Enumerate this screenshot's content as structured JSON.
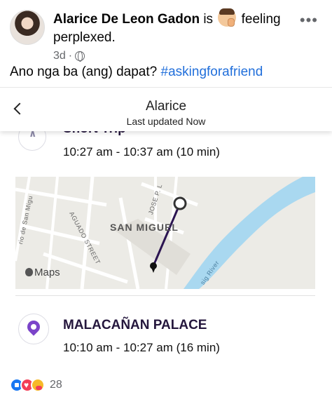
{
  "post": {
    "author": "Alarice De Leon Gadon",
    "is_text": " is ",
    "emoji_name": "perplexed-face-emoji",
    "feeling_text": " feeling perplexed.",
    "time": "3d",
    "audience_icon": "globe-icon",
    "more_icon": "more-options-icon",
    "text": "Ano nga ba (ang) dapat? ",
    "hashtag": "#askingforafriend"
  },
  "app": {
    "title": "Alarice",
    "subtitle": "Last updated Now",
    "back_icon": "chevron-left-icon",
    "trip": {
      "title": "Short Trip",
      "time": "10:27 am - 10:37 am (10 min)"
    },
    "map": {
      "district": "SAN MIGUEL",
      "street_1": "AGUADO STREET",
      "street_2": "JOSE P. L",
      "street_3": "rio de San Migu",
      "river": "sig River",
      "badge": "Maps",
      "colors": {
        "water": "#a9d8f0",
        "route": "#2b1451",
        "land": "#ecebe6",
        "road": "#ffffff"
      }
    },
    "place": {
      "title": "MALACAÑAN PALACE",
      "time": "10:10 am - 10:27 am (16 min)",
      "icon": "location-pin-icon",
      "color": "#7b44c9"
    }
  },
  "reactions": {
    "icons": [
      "like-reaction-icon",
      "love-reaction-icon",
      "care-reaction-icon"
    ],
    "count": "28"
  }
}
